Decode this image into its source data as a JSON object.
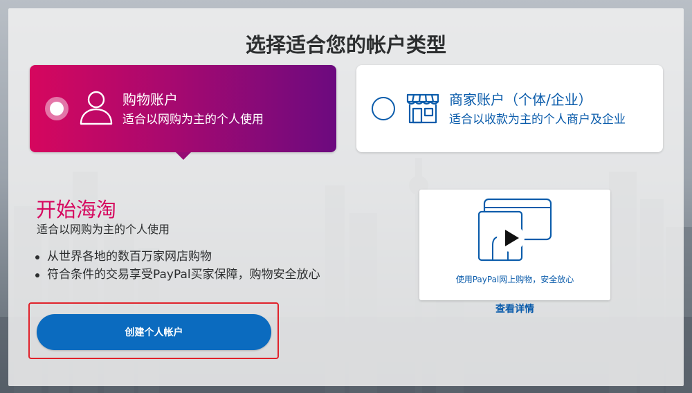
{
  "page": {
    "title": "选择适合您的帐户类型"
  },
  "account_types": {
    "personal": {
      "title": "购物账户",
      "subtitle": "适合以网购为主的个人使用",
      "selected": true
    },
    "business": {
      "title": "商家账户（个体/企业）",
      "subtitle": "适合以收款为主的个人商户及企业",
      "selected": false
    }
  },
  "details": {
    "heading": "开始海淘",
    "subheading": "适合以网购为主的个人使用",
    "features": [
      "从世界各地的数百万家网店购物",
      "符合条件的交易享受PayPal买家保障，购物安全放心"
    ],
    "create_button": "创建个人帐户"
  },
  "video": {
    "caption": "使用PayPal网上购物，安全放心",
    "details_link": "查看详情"
  },
  "colors": {
    "brand_pink": "#d6075e",
    "brand_purple": "#6c0a7f",
    "brand_blue": "#0b5cab",
    "button_blue": "#0b6bbf",
    "highlight_red": "#e0222b"
  },
  "icons": {
    "personal": "person-icon",
    "business": "storefront-icon",
    "video": "play-icon"
  }
}
